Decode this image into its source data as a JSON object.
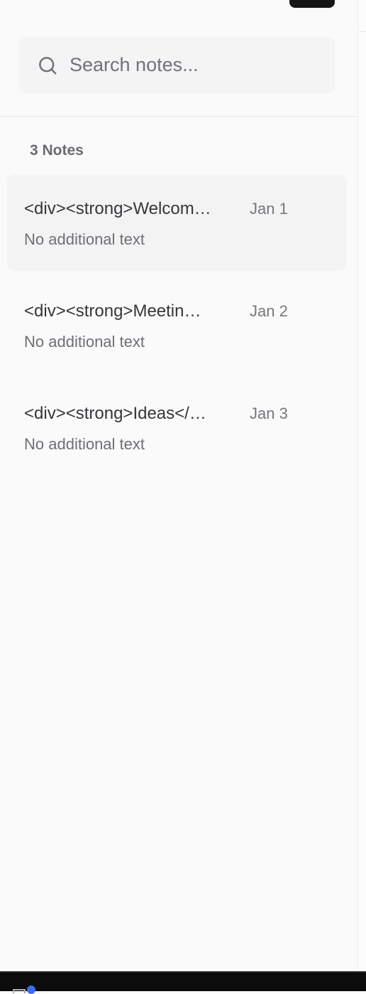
{
  "search": {
    "placeholder": "Search notes..."
  },
  "notes_count": "3 Notes",
  "notes": [
    {
      "title": "<div><strong>Welcom…",
      "date": "Jan 1",
      "preview": "No additional text",
      "selected": true
    },
    {
      "title": "<div><strong>Meetin…",
      "date": "Jan 2",
      "preview": "No additional text",
      "selected": false
    },
    {
      "title": "<div><strong>Ideas</…",
      "date": "Jan 3",
      "preview": "No additional text",
      "selected": false
    }
  ]
}
